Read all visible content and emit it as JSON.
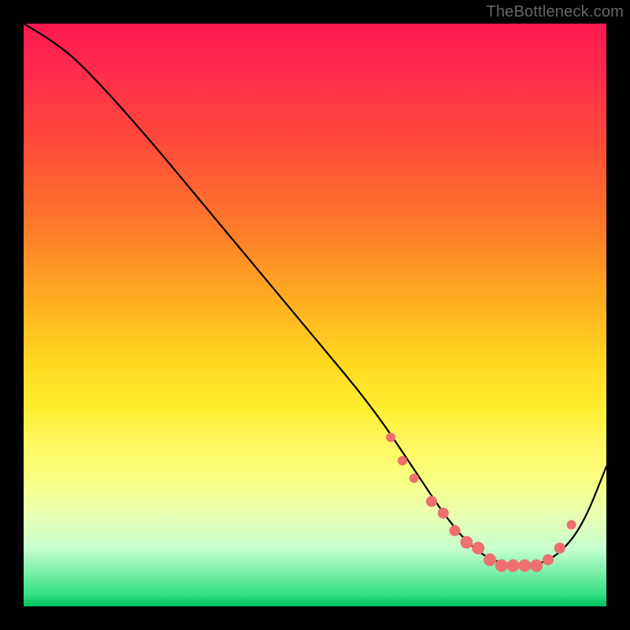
{
  "watermark": "TheBottleneck.com",
  "chart_data": {
    "type": "line",
    "title": "",
    "xlabel": "",
    "ylabel": "",
    "xlim": [
      0,
      100
    ],
    "ylim": [
      0,
      100
    ],
    "series": [
      {
        "name": "curve",
        "x": [
          0,
          5,
          10,
          20,
          30,
          40,
          50,
          60,
          68,
          72,
          76,
          80,
          84,
          88,
          92,
          96,
          100
        ],
        "y": [
          100,
          97,
          93,
          82,
          70,
          58,
          46,
          34,
          22,
          16,
          11,
          8,
          7,
          7,
          9,
          14,
          24
        ]
      }
    ],
    "markers": {
      "name": "dots",
      "x": [
        63,
        65,
        67,
        70,
        72,
        74,
        76,
        78,
        80,
        82,
        84,
        86,
        88,
        90,
        92,
        94
      ],
      "y": [
        29,
        25,
        22,
        18,
        16,
        13,
        11,
        10,
        8,
        7,
        7,
        7,
        7,
        8,
        10,
        14
      ],
      "marker_size": [
        6,
        6,
        6,
        7,
        7,
        7,
        8,
        8,
        8,
        8,
        8,
        8,
        8,
        7,
        7,
        6
      ],
      "marker_color": "#ef6f6f"
    }
  }
}
